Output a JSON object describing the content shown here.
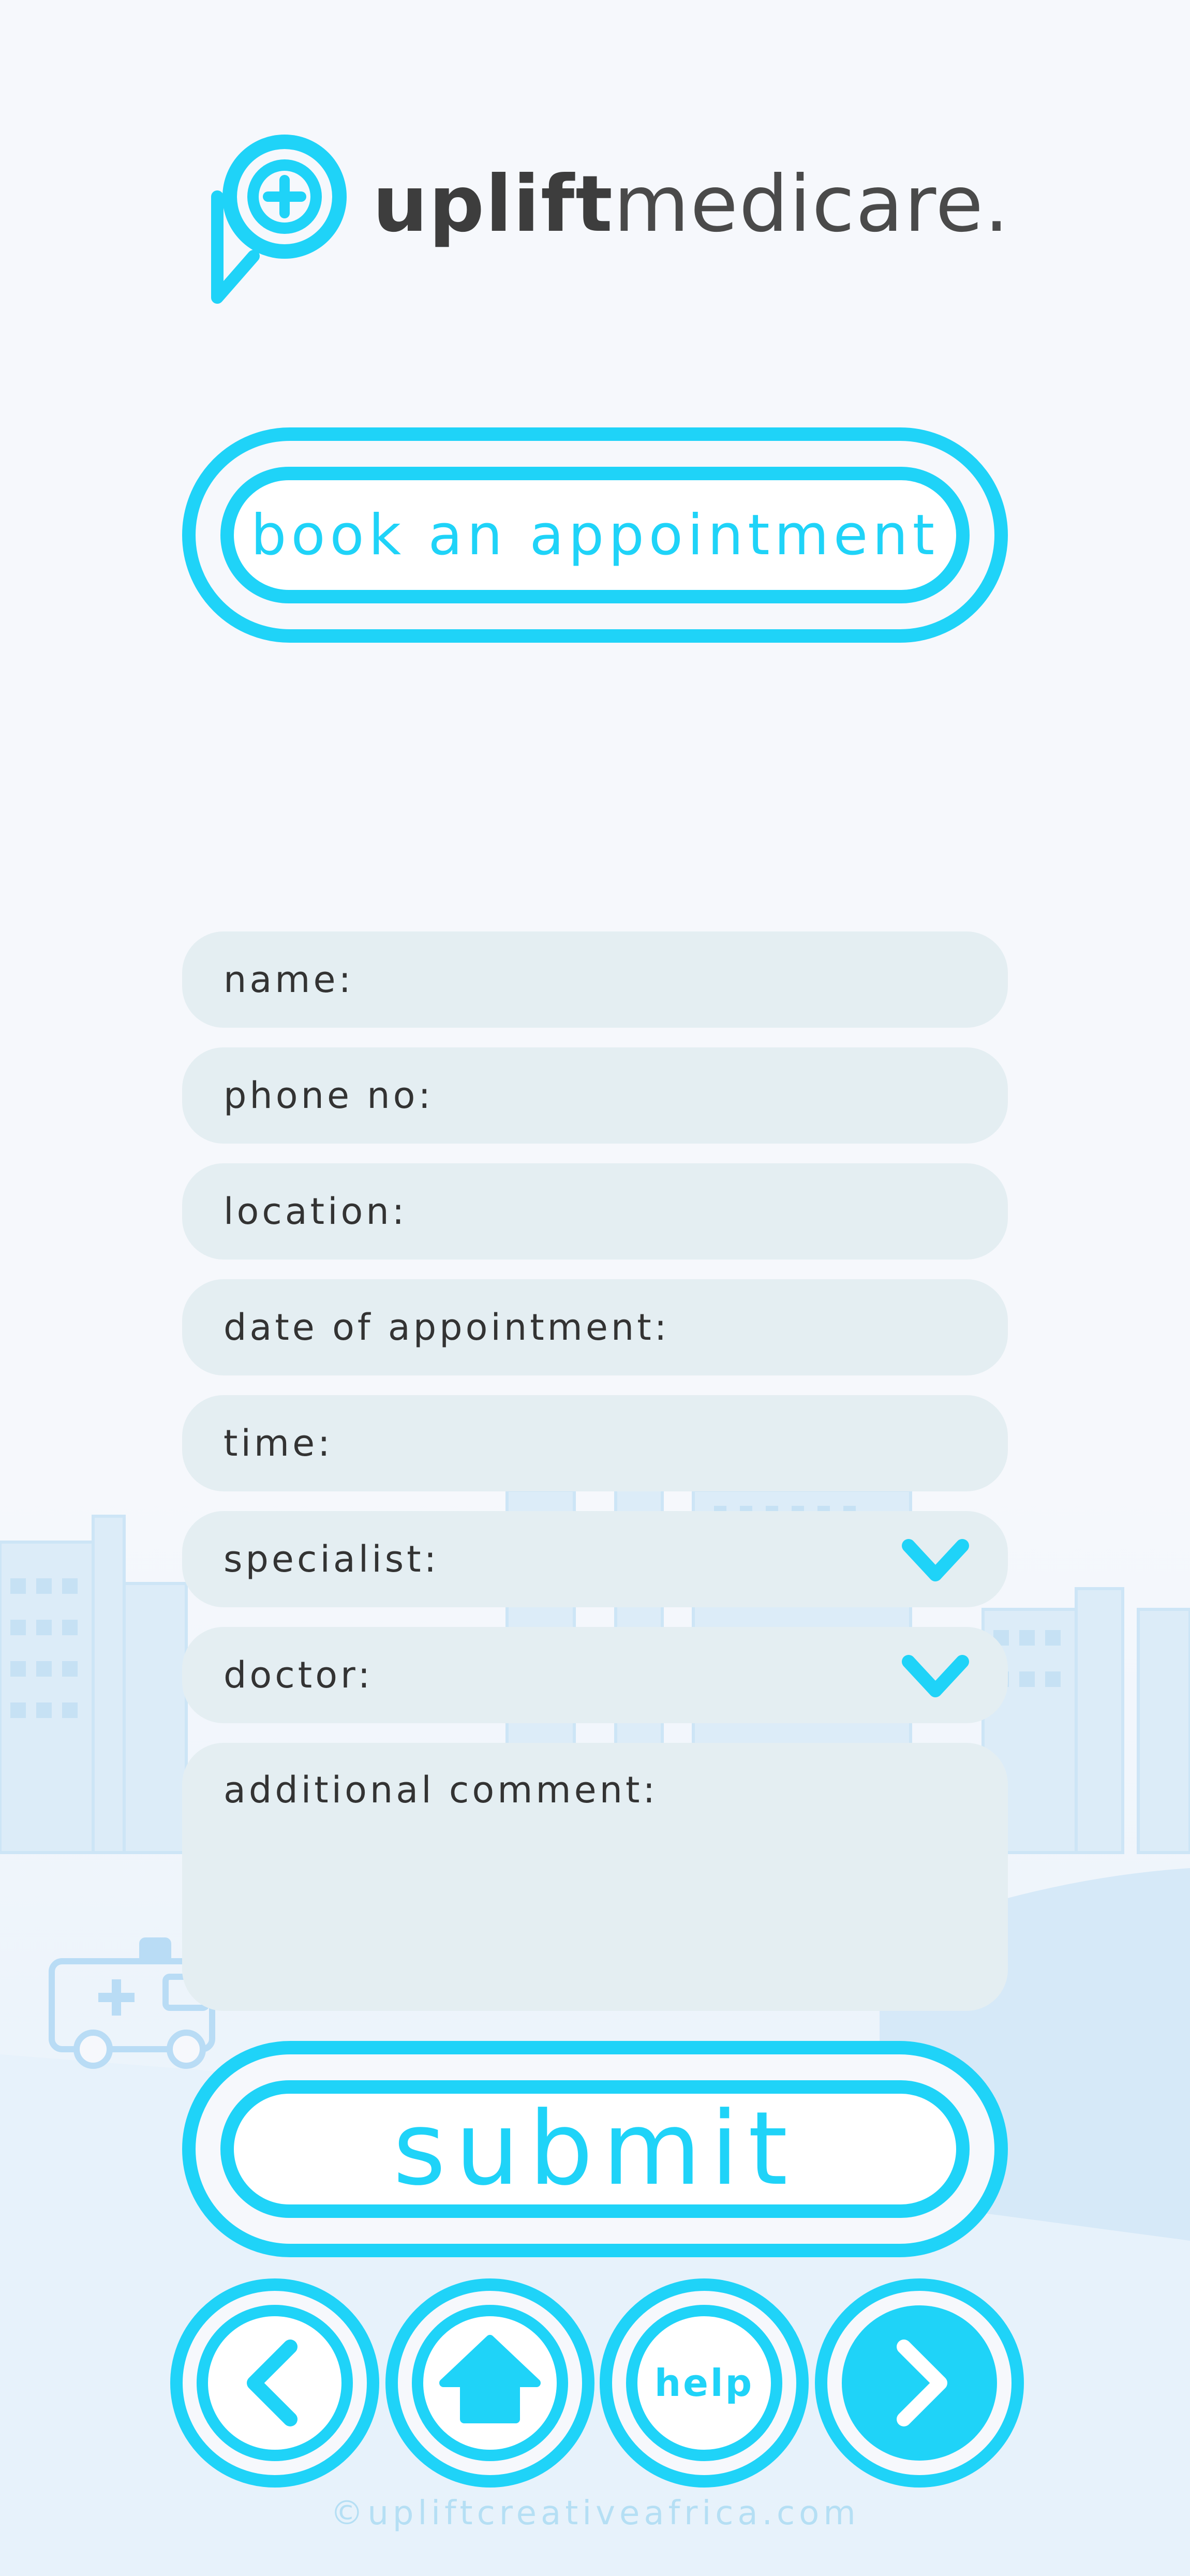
{
  "brand": {
    "bold": "uplift",
    "light": "medicare."
  },
  "header": {
    "book_label": "book an appointment"
  },
  "form": {
    "name_label": "name:",
    "phone_label": "phone no:",
    "location_label": "location:",
    "date_label": "date of appointment:",
    "time_label": "time:",
    "specialist_label": "specialist:",
    "doctor_label": "doctor:",
    "comment_label": "additional comment:"
  },
  "actions": {
    "submit_label": "submit"
  },
  "nav": {
    "help_label": "help"
  },
  "footer": {
    "copyright": "©upliftcreativeafrica.com"
  },
  "icons": [
    "location-pin-icon",
    "plus-icon",
    "chevron-down-icon",
    "chevron-left-icon",
    "home-icon",
    "chevron-right-icon",
    "copyright-icon",
    "ambulance-icon"
  ],
  "colors": {
    "accent": "#1fd3f8",
    "field_bg": "#e4eef2",
    "text": "#333333",
    "page_bg": "#f6f8fc",
    "skyline": "#c8e6f7"
  }
}
